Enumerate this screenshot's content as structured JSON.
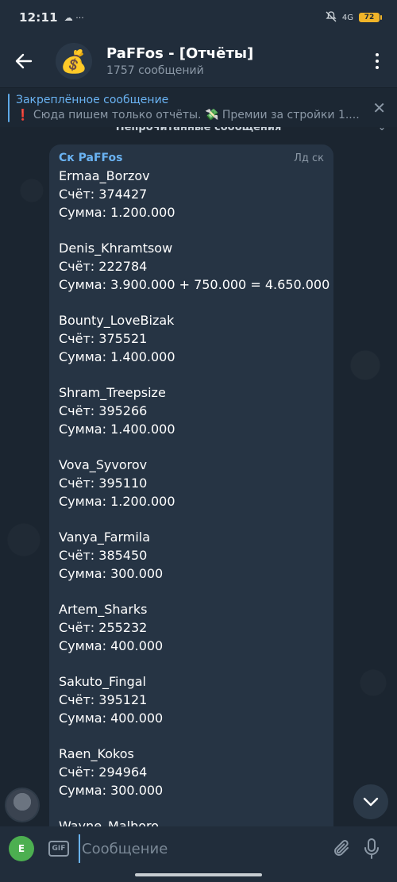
{
  "status": {
    "time": "12:11",
    "left_icons": "☁ ···",
    "network": "4G",
    "battery": "72"
  },
  "header": {
    "avatar_emoji": "💰",
    "title": "PaFFos - [Отчёты]",
    "subtitle": "1757 сообщений"
  },
  "pinned": {
    "label": "Закреплённое сообщение",
    "excl": "❗",
    "text": " Сюда пишем только отчёты. 💸 Премии за стройки  1...."
  },
  "unread_banner": "Непрочитанные сообщения",
  "message": {
    "sender": "Ск PaFFos",
    "tag": "Лд ск",
    "entries": [
      {
        "name": "Ermaa_Borzov",
        "account": "Счёт: 374427",
        "sum": "Сумма: 1.200.000"
      },
      {
        "name": "Denis_Khramtsow",
        "account": "Счёт: 222784",
        "sum": "Сумма: 3.900.000 + 750.000 = 4.650.000"
      },
      {
        "name": "Bounty_LoveBizak",
        "account": "Счёт: 375521",
        "sum": "Сумма: 1.400.000"
      },
      {
        "name": "Shram_Treepsize",
        "account": "Счёт: 395266",
        "sum": "Сумма: 1.400.000"
      },
      {
        "name": "Vova_Syvorov",
        "account": "Счёт: 395110",
        "sum": "Сумма: 1.200.000"
      },
      {
        "name": "Vanya_Farmila",
        "account": "Счёт: 385450",
        "sum": "Сумма: 300.000"
      },
      {
        "name": "Artem_Sharks",
        "account": "Счёт: 255232",
        "sum": "Сумма: 400.000"
      },
      {
        "name": "Sakuto_Fingal",
        "account": "Счёт: 395121",
        "sum": "Сумма: 400.000"
      },
      {
        "name": "Raen_Kokos",
        "account": "Счёт: 294964",
        "sum": "Сумма: 300.000"
      },
      {
        "name": "Wayne_Malboro",
        "account": "",
        "sum": ""
      }
    ]
  },
  "input": {
    "emoji_letter": "E",
    "gif_label": "GIF",
    "placeholder": "Сообщение"
  }
}
